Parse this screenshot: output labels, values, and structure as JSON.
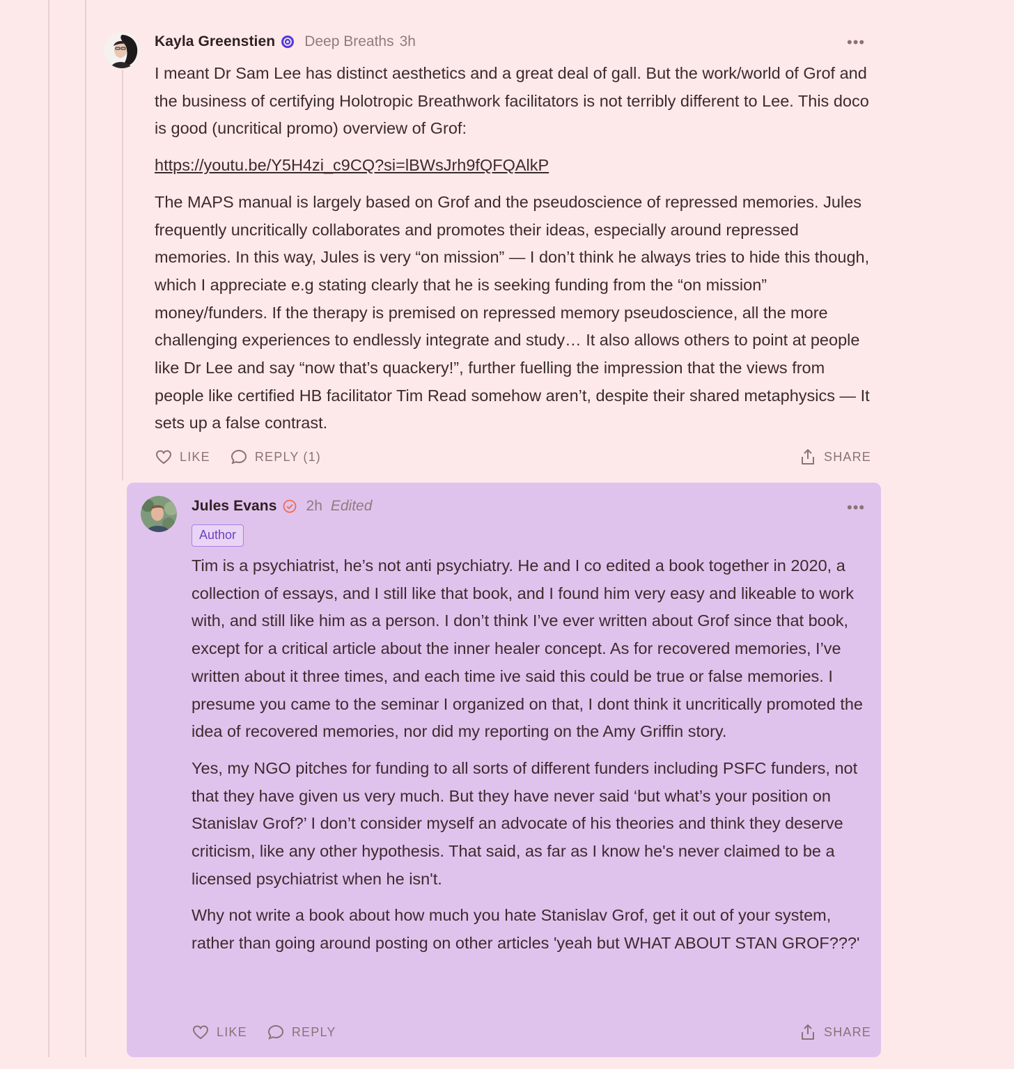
{
  "thread": {
    "comment1": {
      "author": "Kayla Greenstien",
      "publication": "Deep Breaths",
      "time": "3h",
      "paragraphs": [
        "I meant Dr Sam Lee has distinct aesthetics and a great deal of gall. But the work/world of Grof and the business of certifying Holotropic Breathwork facilitators is not terribly different to Lee. This doco is good (uncritical promo) overview of Grof:",
        "The MAPS manual is largely based on Grof and the pseudoscience of repressed memories. Jules frequently uncritically collaborates and promotes their ideas, especially around repressed memories. In this way, Jules is very “on mission” — I don’t think he always tries to hide this though, which I appreciate e.g stating clearly that he is seeking funding from the “on mission” money/funders. If the therapy is premised on repressed memory pseudoscience, all the more challenging experiences to endlessly integrate and study… It also allows others to point at people like Dr Lee and say “now that’s quackery!”, further fuelling the impression that the views from people like certified HB facilitator Tim Read somehow aren’t, despite their shared metaphysics — It sets up a false contrast."
      ],
      "link": "https://youtu.be/Y5H4zi_c9CQ?si=lBWsJrh9fQFQAlkP",
      "like_label": "LIKE",
      "reply_label": "REPLY (1)",
      "share_label": "SHARE"
    },
    "comment2": {
      "author": "Jules Evans",
      "time": "2h",
      "edited": "Edited",
      "tag": "Author",
      "paragraphs": [
        "Tim is a psychiatrist, he’s not anti psychiatry. He and I co edited a book together in 2020, a collection of essays, and I still like that book, and I found him very easy and likeable to work with, and still like him as a person. I don’t think I’ve ever written about Grof since that book, except for a critical article about the inner healer concept. As for recovered memories, I’ve written about it three times, and each time ive said this could be true or false memories. I presume you came to the seminar I organized on that, I dont think it uncritically promoted the idea of recovered memories, nor did my reporting on the Amy Griffin story.",
        "Yes, my NGO pitches for funding to all sorts of different funders including PSFC funders, not that they have given us very much. But they have never said ‘but what’s your position on Stanislav Grof?’ I don’t consider myself an advocate of his theories and think they deserve criticism, like any other hypothesis. That said, as far as I know he's never claimed to be a licensed psychiatrist when he isn't.",
        "Why not write a book about how much you hate Stanislav Grof, get it out of your system, rather than going around posting on other articles 'yeah but WHAT ABOUT STAN GROF???'"
      ],
      "like_label": "LIKE",
      "reply_label": "REPLY",
      "share_label": "SHARE"
    }
  },
  "colors": {
    "background": "#fde9ea",
    "author_card": "#e0c3ed",
    "verified_badge": "#f26a4b",
    "publication_badge": "#5b3bd6"
  }
}
